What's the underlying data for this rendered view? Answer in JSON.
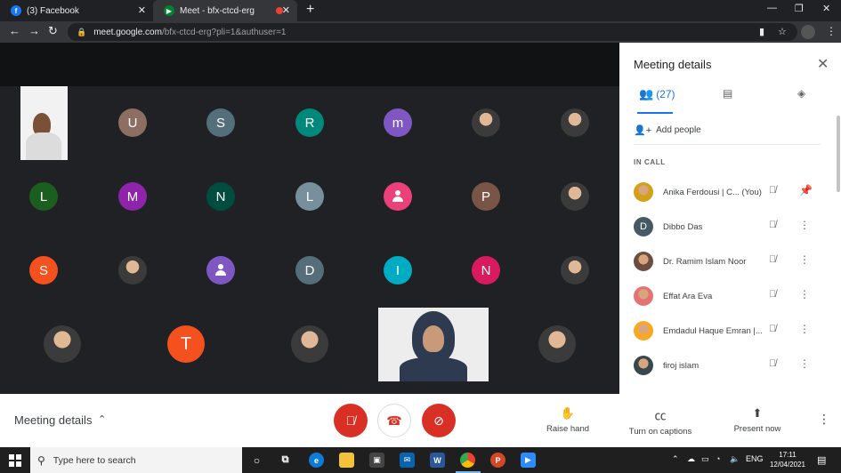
{
  "browser": {
    "tabs": [
      {
        "title": "(3) Facebook",
        "icon": "facebook-icon",
        "active": false
      },
      {
        "title": "Meet - bfx-ctcd-erg",
        "icon": "google-meet-icon",
        "active": true
      }
    ],
    "url_host": "meet.google.com",
    "url_path": "/bfx-ctcd-erg?pli=1&authuser=1"
  },
  "grid": {
    "tiles": [
      {
        "kind": "video"
      },
      {
        "kind": "letter",
        "letter": "U",
        "color": "#8d6e63"
      },
      {
        "kind": "letter",
        "letter": "S",
        "color": "#546e7a"
      },
      {
        "kind": "letter",
        "letter": "R",
        "color": "#00897b"
      },
      {
        "kind": "letter",
        "letter": "m",
        "color": "#7e57c2"
      },
      {
        "kind": "photo"
      },
      {
        "kind": "photo"
      },
      {
        "kind": "letter",
        "letter": "L",
        "color": "#1b5e20"
      },
      {
        "kind": "letter",
        "letter": "M",
        "color": "#8e24aa"
      },
      {
        "kind": "letter",
        "letter": "N",
        "color": "#004d40"
      },
      {
        "kind": "letter",
        "letter": "L",
        "color": "#78909c"
      },
      {
        "kind": "default-avatar",
        "color": "#ec407a"
      },
      {
        "kind": "letter",
        "letter": "P",
        "color": "#795548"
      },
      {
        "kind": "photo"
      },
      {
        "kind": "letter",
        "letter": "S",
        "color": "#f4511e"
      },
      {
        "kind": "photo"
      },
      {
        "kind": "default-avatar",
        "color": "#7e57c2"
      },
      {
        "kind": "letter",
        "letter": "D",
        "color": "#546e7a"
      },
      {
        "kind": "letter",
        "letter": "I",
        "color": "#00acc1"
      },
      {
        "kind": "letter",
        "letter": "N",
        "color": "#d81b60"
      },
      {
        "kind": "photo"
      },
      {
        "kind": "photo"
      },
      {
        "kind": "letter",
        "letter": "T",
        "color": "#f4511e"
      },
      {
        "kind": "photo"
      },
      {
        "kind": "video"
      },
      {
        "kind": "photo"
      }
    ]
  },
  "panel": {
    "title": "Meeting details",
    "people_count": "(27)",
    "add_people": "Add people",
    "in_call": "IN CALL",
    "participants": [
      {
        "name": "Anika Ferdousi | C... (You)",
        "avatar": "photo",
        "color": "#d4a017",
        "action": "pin-icon"
      },
      {
        "name": "Dibbo Das",
        "avatar": "letter",
        "letter": "D",
        "color": "#455a64",
        "action": "more-icon"
      },
      {
        "name": "Dr. Ramim Islam Noor",
        "avatar": "photo",
        "color": "#6d4c41",
        "action": "more-icon"
      },
      {
        "name": "Effat Ara Eva",
        "avatar": "photo",
        "color": "#e57373",
        "action": "more-icon"
      },
      {
        "name": "Emdadul Haque Emran |...",
        "avatar": "photo",
        "color": "#f9a825",
        "action": "more-icon"
      },
      {
        "name": "firoj islam",
        "avatar": "photo",
        "color": "#37474f",
        "action": "more-icon"
      }
    ]
  },
  "bottom": {
    "meeting_details": "Meeting details",
    "raise_hand": "Raise hand",
    "captions": "Turn on captions",
    "present": "Present now"
  },
  "taskbar": {
    "search_placeholder": "Type here to search",
    "lang": "ENG",
    "time": "17:11",
    "date": "12/04/2021"
  },
  "colors": {
    "accent": "#1a73e8",
    "danger": "#d93025",
    "stage": "#202124"
  }
}
